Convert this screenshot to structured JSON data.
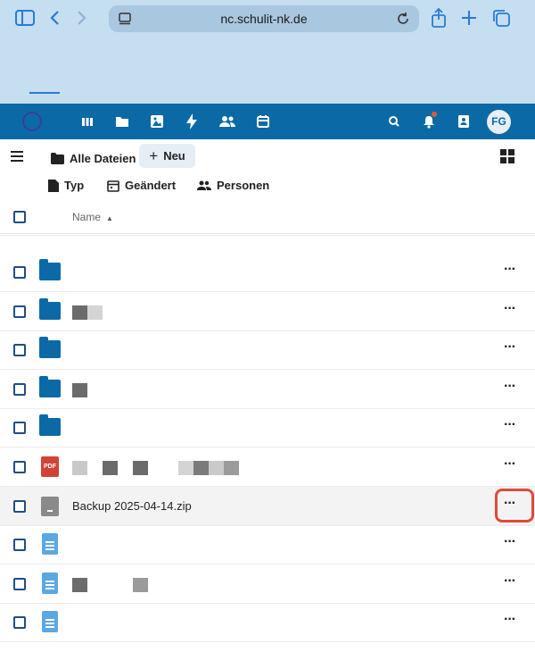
{
  "browser": {
    "url": "nc.schulit-nk.de"
  },
  "header": {
    "avatar_initials": "FG"
  },
  "toolbar": {
    "all_files_label": "Alle Dateien",
    "new_label": "Neu"
  },
  "filters": {
    "type_label": "Typ",
    "modified_label": "Geändert",
    "people_label": "Personen"
  },
  "table": {
    "name_header": "Name",
    "rows": [
      {
        "icon": "folder-icon",
        "name": ""
      },
      {
        "icon": "folder-icon",
        "name": ""
      },
      {
        "icon": "folder-icon",
        "name": ""
      },
      {
        "icon": "folder-icon",
        "name": ""
      },
      {
        "icon": "folder-icon",
        "name": ""
      },
      {
        "icon": "pdf-file-icon",
        "name": ""
      },
      {
        "icon": "zip-file-icon",
        "name": "Backup 2025-04-14.zip",
        "highlighted": true
      },
      {
        "icon": "document-icon",
        "name": ""
      },
      {
        "icon": "document-icon",
        "name": ""
      },
      {
        "icon": "document-icon",
        "name": ""
      }
    ],
    "more_glyph": "···"
  },
  "colors": {
    "header_blue": "#0b6aa5",
    "highlight_red": "#e24a3b"
  }
}
